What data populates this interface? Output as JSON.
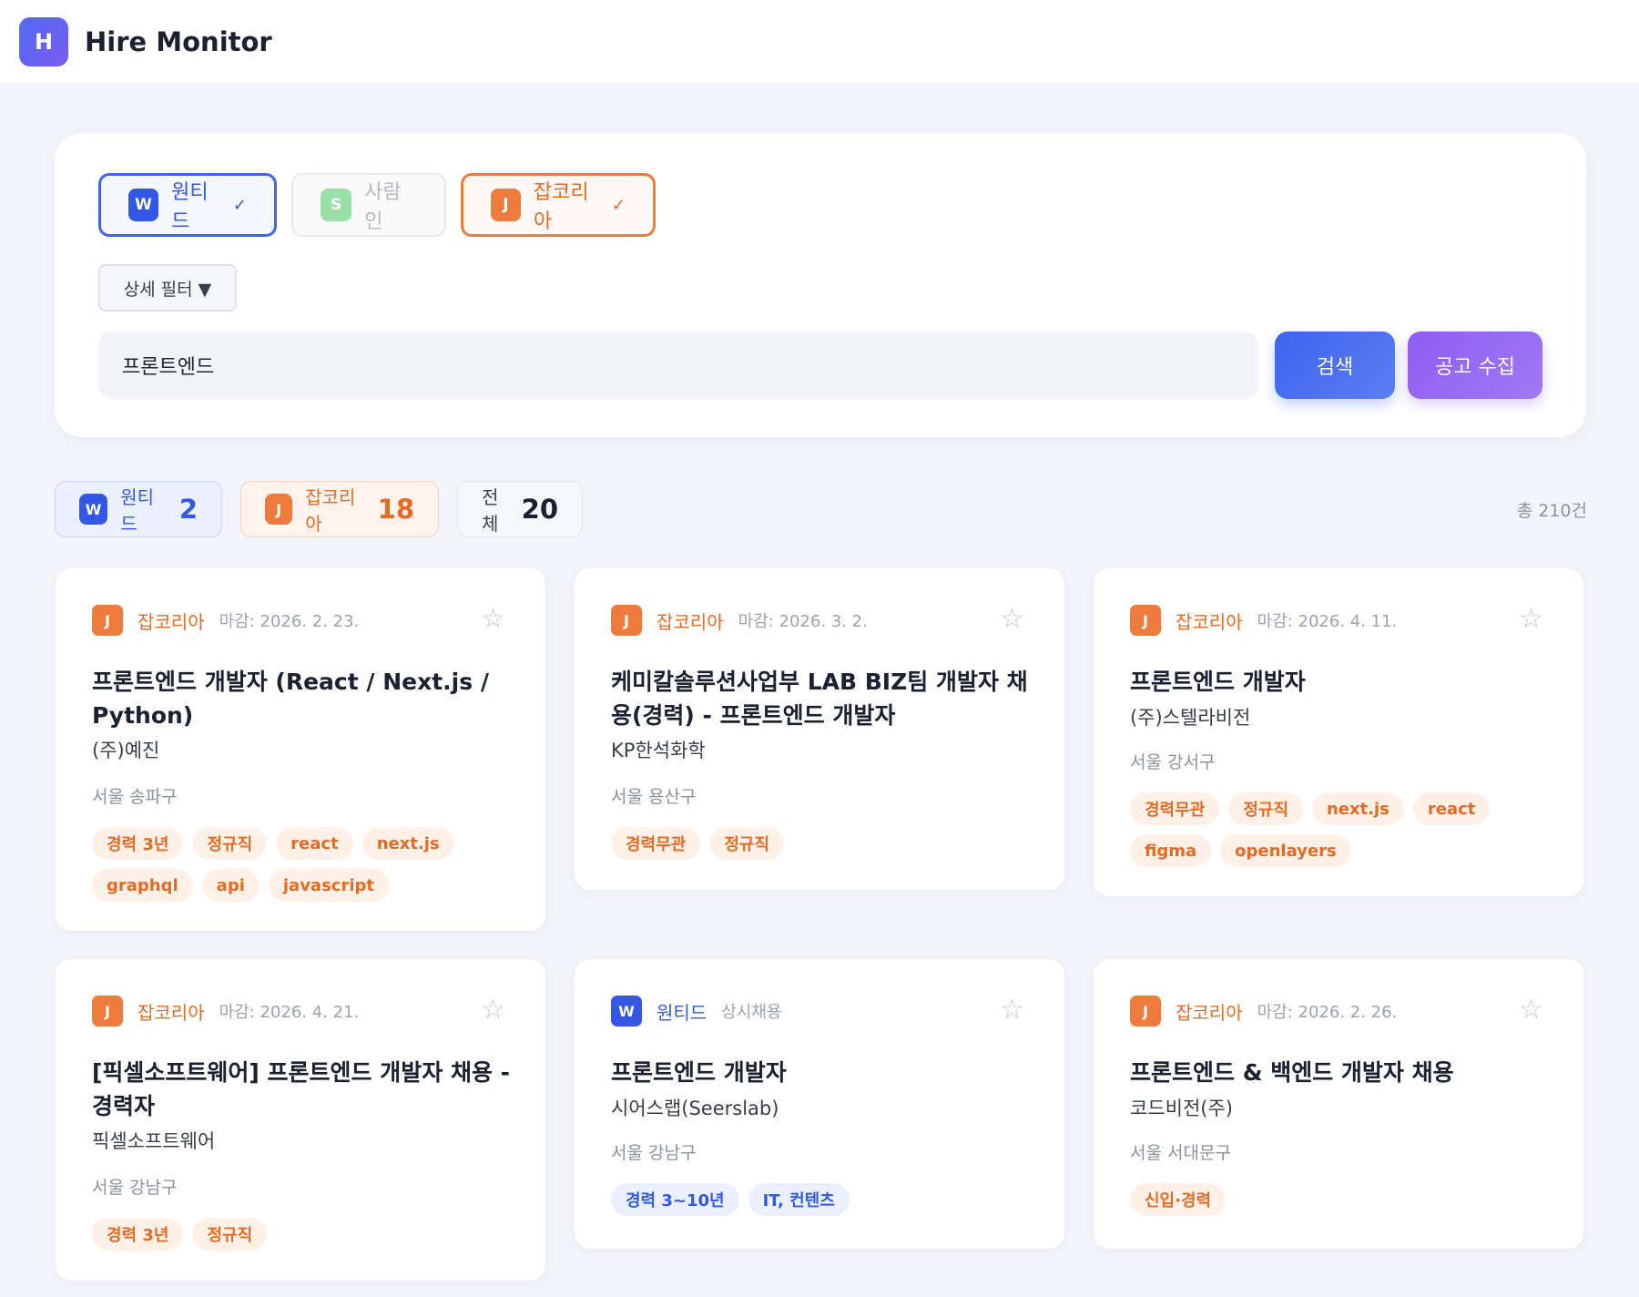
{
  "header": {
    "logo_letter": "H",
    "title": "Hire Monitor"
  },
  "sources": {
    "wanted": {
      "letter": "W",
      "label": "원티드",
      "check": "✓"
    },
    "saramin": {
      "letter": "S",
      "label": "사람인"
    },
    "jobkorea": {
      "letter": "J",
      "label": "잡코리아",
      "check": "✓"
    }
  },
  "filter": {
    "detail_label": "상세 필터 ▼"
  },
  "search": {
    "value": "프론트엔드",
    "search_button": "검색",
    "collect_button": "공고 수집"
  },
  "stats": {
    "wanted": {
      "letter": "W",
      "label": "원티드",
      "count": "2"
    },
    "jobkorea": {
      "letter": "J",
      "label": "잡코리아",
      "count": "18"
    },
    "all": {
      "label": "전체",
      "count": "20"
    },
    "total": "총 210건"
  },
  "cards": [
    {
      "letter": "J",
      "source": "잡코리아",
      "deadline": "마감: 2026. 2. 23.",
      "star": "☆",
      "title": "프론트엔드 개발자 (React / Next.js / Python)",
      "company": "(주)예진",
      "location": "서울 송파구",
      "tags": [
        "경력 3년",
        "정규직",
        "react",
        "next.js",
        "graphql",
        "api",
        "javascript"
      ]
    },
    {
      "letter": "J",
      "source": "잡코리아",
      "deadline": "마감: 2026. 3. 2.",
      "star": "☆",
      "title": "케미칼솔루션사업부 LAB BIZ팀 개발자 채용(경력) - 프론트엔드 개발자",
      "company": "KP한석화학",
      "location": "서울 용산구",
      "tags": [
        "경력무관",
        "정규직"
      ]
    },
    {
      "letter": "J",
      "source": "잡코리아",
      "deadline": "마감: 2026. 4. 11.",
      "star": "☆",
      "title": "프론트엔드 개발자",
      "company": "(주)스텔라비전",
      "location": "서울 강서구",
      "tags": [
        "경력무관",
        "정규직",
        "next.js",
        "react",
        "figma",
        "openlayers"
      ]
    },
    {
      "letter": "J",
      "source": "잡코리아",
      "deadline": "마감: 2026. 4. 21.",
      "star": "☆",
      "title": "[픽셀소프트웨어] 프론트엔드 개발자 채용 - 경력자",
      "company": "픽셀소프트웨어",
      "location": "서울 강남구",
      "tags": [
        "경력 3년",
        "정규직"
      ]
    },
    {
      "letter": "W",
      "source": "원티드",
      "deadline": "상시채용",
      "star": "☆",
      "title": "프론트엔드 개발자",
      "company": "시어스랩(Seerslab)",
      "location": "서울 강남구",
      "tags": [
        "경력 3~10년",
        "IT, 컨텐츠"
      ]
    },
    {
      "letter": "J",
      "source": "잡코리아",
      "deadline": "마감: 2026. 2. 26.",
      "star": "☆",
      "title": "프론트엔드 & 백엔드 개발자 채용",
      "company": "코드비전(주)",
      "location": "서울 서대문구",
      "tags": [
        "신입·경력"
      ]
    }
  ]
}
